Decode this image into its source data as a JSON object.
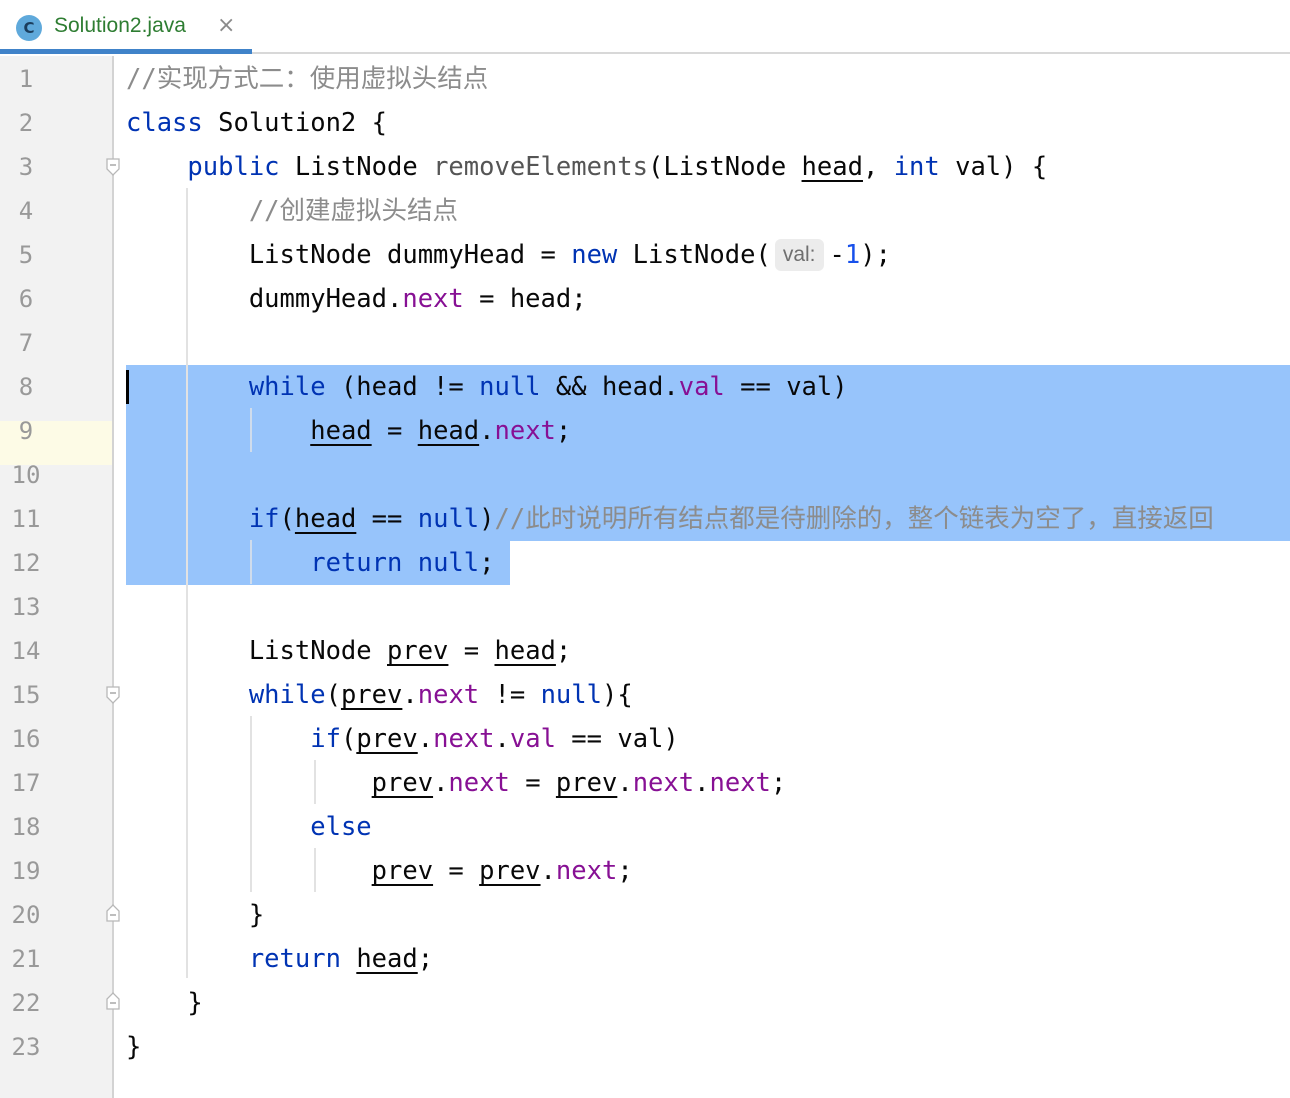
{
  "tab": {
    "icon_letter": "C",
    "file_name": "Solution2.java",
    "close_glyph": "×"
  },
  "editor": {
    "line_numbers": [
      "1",
      "2",
      "3",
      "4",
      "5",
      "6",
      "7",
      "8",
      "9",
      "10",
      "11",
      "12",
      "13",
      "14",
      "15",
      "16",
      "17",
      "18",
      "19",
      "20",
      "21",
      "22",
      "23"
    ],
    "current_line": 8,
    "selection_lines": "8-12",
    "lines": [
      {
        "n": 1,
        "tokens": [
          {
            "t": "//实现方式二：使用虚拟头结点",
            "c": "cmt"
          }
        ]
      },
      {
        "n": 2,
        "tokens": [
          {
            "t": "class",
            "c": "kw"
          },
          {
            "t": " Solution2 {",
            "c": ""
          }
        ]
      },
      {
        "n": 3,
        "tokens": [
          {
            "t": "    "
          },
          {
            "t": "public",
            "c": "kw"
          },
          {
            "t": " ListNode ",
            "c": ""
          },
          {
            "t": "removeElements",
            "c": "mth"
          },
          {
            "t": "(ListNode ",
            "c": ""
          },
          {
            "t": "head",
            "c": "u"
          },
          {
            "t": ", ",
            "c": ""
          },
          {
            "t": "int",
            "c": "kw"
          },
          {
            "t": " val) {",
            "c": ""
          }
        ]
      },
      {
        "n": 4,
        "tokens": [
          {
            "t": "        "
          },
          {
            "t": "//创建虚拟头结点",
            "c": "cmt"
          }
        ]
      },
      {
        "n": 5,
        "tokens": [
          {
            "t": "        ListNode dummyHead = ",
            "c": ""
          },
          {
            "t": "new",
            "c": "kw"
          },
          {
            "t": " ListNode(",
            "c": ""
          },
          {
            "t": "val:",
            "c": "hint"
          },
          {
            "t": "-",
            "c": ""
          },
          {
            "t": "1",
            "c": "num"
          },
          {
            "t": ");",
            "c": ""
          }
        ]
      },
      {
        "n": 6,
        "tokens": [
          {
            "t": "        dummyHead.",
            "c": ""
          },
          {
            "t": "next",
            "c": "fld"
          },
          {
            "t": " = head;",
            "c": ""
          }
        ]
      },
      {
        "n": 7,
        "tokens": []
      },
      {
        "n": 8,
        "tokens": [
          {
            "t": "        "
          },
          {
            "t": "while",
            "c": "kw"
          },
          {
            "t": " (head != ",
            "c": ""
          },
          {
            "t": "null",
            "c": "kw"
          },
          {
            "t": " && head.",
            "c": ""
          },
          {
            "t": "val",
            "c": "fld"
          },
          {
            "t": " == val)",
            "c": ""
          }
        ]
      },
      {
        "n": 9,
        "tokens": [
          {
            "t": "            "
          },
          {
            "t": "head",
            "c": "u"
          },
          {
            "t": " = ",
            "c": ""
          },
          {
            "t": "head",
            "c": "u"
          },
          {
            "t": ".",
            "c": ""
          },
          {
            "t": "next",
            "c": "fld"
          },
          {
            "t": ";",
            "c": ""
          }
        ]
      },
      {
        "n": 10,
        "tokens": []
      },
      {
        "n": 11,
        "tokens": [
          {
            "t": "        "
          },
          {
            "t": "if",
            "c": "kw"
          },
          {
            "t": "(",
            "c": ""
          },
          {
            "t": "head",
            "c": "u"
          },
          {
            "t": " == ",
            "c": ""
          },
          {
            "t": "null",
            "c": "kw"
          },
          {
            "t": ")",
            "c": ""
          },
          {
            "t": "//此时说明所有结点都是待删除的，整个链表为空了，直接返回",
            "c": "cmt"
          }
        ]
      },
      {
        "n": 12,
        "tokens": [
          {
            "t": "            "
          },
          {
            "t": "return",
            "c": "kw"
          },
          {
            "t": " ",
            "c": ""
          },
          {
            "t": "null",
            "c": "kw"
          },
          {
            "t": ";",
            "c": ""
          }
        ]
      },
      {
        "n": 13,
        "tokens": []
      },
      {
        "n": 14,
        "tokens": [
          {
            "t": "        ListNode ",
            "c": ""
          },
          {
            "t": "prev",
            "c": "u"
          },
          {
            "t": " = ",
            "c": ""
          },
          {
            "t": "head",
            "c": "u"
          },
          {
            "t": ";",
            "c": ""
          }
        ]
      },
      {
        "n": 15,
        "tokens": [
          {
            "t": "        "
          },
          {
            "t": "while",
            "c": "kw"
          },
          {
            "t": "(",
            "c": ""
          },
          {
            "t": "prev",
            "c": "u"
          },
          {
            "t": ".",
            "c": ""
          },
          {
            "t": "next",
            "c": "fld"
          },
          {
            "t": " != ",
            "c": ""
          },
          {
            "t": "null",
            "c": "kw"
          },
          {
            "t": "){",
            "c": ""
          }
        ]
      },
      {
        "n": 16,
        "tokens": [
          {
            "t": "            "
          },
          {
            "t": "if",
            "c": "kw"
          },
          {
            "t": "(",
            "c": ""
          },
          {
            "t": "prev",
            "c": "u"
          },
          {
            "t": ".",
            "c": ""
          },
          {
            "t": "next",
            "c": "fld"
          },
          {
            "t": ".",
            "c": ""
          },
          {
            "t": "val",
            "c": "fld"
          },
          {
            "t": " == val)",
            "c": ""
          }
        ]
      },
      {
        "n": 17,
        "tokens": [
          {
            "t": "                "
          },
          {
            "t": "prev",
            "c": "u"
          },
          {
            "t": ".",
            "c": ""
          },
          {
            "t": "next",
            "c": "fld"
          },
          {
            "t": " = ",
            "c": ""
          },
          {
            "t": "prev",
            "c": "u"
          },
          {
            "t": ".",
            "c": ""
          },
          {
            "t": "next",
            "c": "fld"
          },
          {
            "t": ".",
            "c": ""
          },
          {
            "t": "next",
            "c": "fld"
          },
          {
            "t": ";",
            "c": ""
          }
        ]
      },
      {
        "n": 18,
        "tokens": [
          {
            "t": "            "
          },
          {
            "t": "else",
            "c": "kw"
          }
        ]
      },
      {
        "n": 19,
        "tokens": [
          {
            "t": "                "
          },
          {
            "t": "prev",
            "c": "u"
          },
          {
            "t": " = ",
            "c": ""
          },
          {
            "t": "prev",
            "c": "u"
          },
          {
            "t": ".",
            "c": ""
          },
          {
            "t": "next",
            "c": "fld"
          },
          {
            "t": ";",
            "c": ""
          }
        ]
      },
      {
        "n": 20,
        "tokens": [
          {
            "t": "        }",
            "c": ""
          }
        ]
      },
      {
        "n": 21,
        "tokens": [
          {
            "t": "        "
          },
          {
            "t": "return",
            "c": "kw"
          },
          {
            "t": " ",
            "c": ""
          },
          {
            "t": "head",
            "c": "u"
          },
          {
            "t": ";",
            "c": ""
          }
        ]
      },
      {
        "n": 22,
        "tokens": [
          {
            "t": "    }",
            "c": ""
          }
        ]
      },
      {
        "n": 23,
        "tokens": [
          {
            "t": "}",
            "c": ""
          }
        ]
      }
    ]
  }
}
